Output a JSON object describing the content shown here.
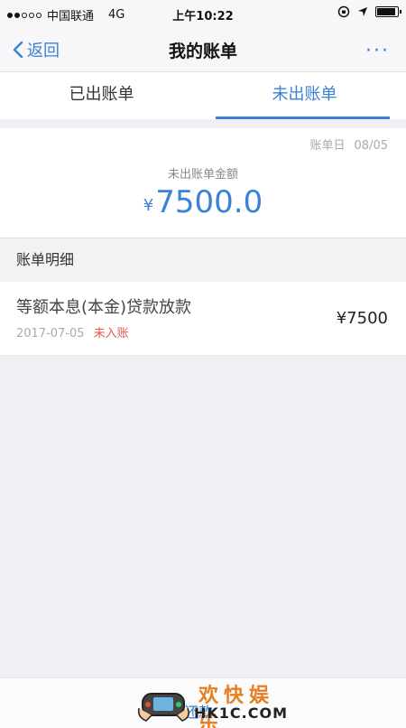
{
  "status_bar": {
    "carrier": "中国联通",
    "network": "4G",
    "time": "上午10:22"
  },
  "nav": {
    "back_label": "返回",
    "title": "我的账单",
    "more_label": "···"
  },
  "tabs": [
    {
      "label": "已出账单",
      "active": false
    },
    {
      "label": "未出账单",
      "active": true
    }
  ],
  "summary": {
    "bill_date_label": "账单日",
    "bill_date_value": "08/05",
    "label": "未出账单金额",
    "currency_symbol": "¥",
    "amount": "7500.0"
  },
  "details": {
    "header": "账单明细",
    "items": [
      {
        "title": "等额本息(本金)贷款放款",
        "date": "2017-07-05",
        "status": "未入账",
        "amount": "¥7500"
      }
    ]
  },
  "bottom": {
    "repay_label": "还款"
  },
  "watermark": {
    "text": "欢快娱乐",
    "sub": "HK1C.COM"
  },
  "colors": {
    "accent": "#3a82d8",
    "status_red": "#e05a4f",
    "background": "#efeff4"
  }
}
